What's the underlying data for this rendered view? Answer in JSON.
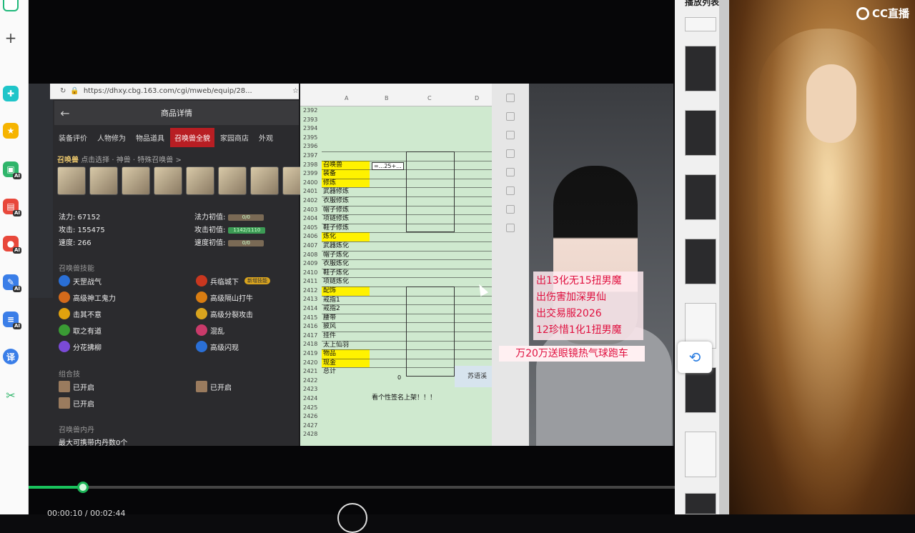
{
  "sidebar": {
    "icons": [
      "home-icon",
      "plus-icon",
      "clover-icon",
      "star-icon",
      "image-ai-icon",
      "pdf-ai-icon",
      "doc-ai-icon",
      "edit-ai-icon",
      "list-ai-icon",
      "translate-icon",
      "scissors-icon"
    ],
    "ai_badge": "AI",
    "translate_glyph": "译"
  },
  "browser": {
    "url": "https://dhxy.cbg.163.com/cgi/mweb/equip/28...",
    "page_title": "商品详情",
    "tabs": [
      "装备评价",
      "人物修为",
      "物品道具",
      "召唤兽全貌",
      "家园商店",
      "外观"
    ],
    "active_tab": "召唤兽全貌",
    "subhead_title": "召唤兽",
    "subhead_rest": "点击选择  ·  神兽  ·  特殊召唤兽 >",
    "stats": {
      "mana_label": "法力: 67152",
      "attack_label": "攻击: 155475",
      "speed_label": "速度: 266",
      "mana_init_label": "法力初值:",
      "mana_init_bar": "0/0",
      "attack_init_label": "攻击初值:",
      "attack_init_bar": "1142/1110",
      "speed_init_label": "速度初值:",
      "speed_init_bar": "0/0"
    },
    "skills_title": "召唤兽技能",
    "skills_left": [
      "天罡战气",
      "高级神工鬼力",
      "击其不意",
      "取之有道",
      "分花拂柳"
    ],
    "skills_right": [
      "兵临城下",
      "高级隔山打牛",
      "高级分裂攻击",
      "混乱",
      "高级闪现"
    ],
    "skill_tag": "新增技能",
    "combo_title": "组合技",
    "combo": [
      "已开启",
      "已开启",
      "已开启"
    ],
    "pill_title": "召唤兽内丹",
    "pill_text": "最大可携带内丹数0个"
  },
  "sheet": {
    "columns": [
      "A",
      "B",
      "C",
      "D"
    ],
    "first_row": 2392,
    "rows": [
      "2392",
      "2393",
      "2394",
      "2395",
      "2396",
      "2397",
      "2398",
      "2399",
      "2400",
      "2401",
      "2402",
      "2403",
      "2404",
      "2405",
      "2406",
      "2407",
      "2408",
      "2409",
      "2410",
      "2411",
      "2412",
      "2413",
      "2414",
      "2415",
      "2416",
      "2417",
      "2418",
      "2419",
      "2420",
      "2421",
      "2422",
      "2423",
      "2424",
      "2425",
      "2426",
      "2427",
      "2428"
    ],
    "labels": [
      {
        "row": 6,
        "text": "召唤兽",
        "yellow": true
      },
      {
        "row": 7,
        "text": "装备",
        "yellow": true
      },
      {
        "row": 8,
        "text": "修炼",
        "yellow": true
      },
      {
        "row": 9,
        "text": "武器修炼",
        "yellow": false
      },
      {
        "row": 10,
        "text": "衣服修炼",
        "yellow": false
      },
      {
        "row": 11,
        "text": "帽子修炼",
        "yellow": false
      },
      {
        "row": 12,
        "text": "项链修炼",
        "yellow": false
      },
      {
        "row": 13,
        "text": "鞋子修炼",
        "yellow": false
      },
      {
        "row": 14,
        "text": "炼化",
        "yellow": true
      },
      {
        "row": 15,
        "text": "武器炼化",
        "yellow": false
      },
      {
        "row": 16,
        "text": "帽子炼化",
        "yellow": false
      },
      {
        "row": 17,
        "text": "衣服炼化",
        "yellow": false
      },
      {
        "row": 18,
        "text": "鞋子炼化",
        "yellow": false
      },
      {
        "row": 19,
        "text": "项链炼化",
        "yellow": false
      },
      {
        "row": 20,
        "text": "配饰",
        "yellow": true
      },
      {
        "row": 21,
        "text": "戒指1",
        "yellow": false
      },
      {
        "row": 22,
        "text": "戒指2",
        "yellow": false
      },
      {
        "row": 23,
        "text": "腰带",
        "yellow": false
      },
      {
        "row": 24,
        "text": "披风",
        "yellow": false
      },
      {
        "row": 25,
        "text": "挂件",
        "yellow": false
      },
      {
        "row": 26,
        "text": "太上仙羽",
        "yellow": false
      },
      {
        "row": 27,
        "text": "物品",
        "yellow": true
      },
      {
        "row": 28,
        "text": "现金",
        "yellow": true
      },
      {
        "row": 29,
        "text": "总计",
        "yellow": false
      }
    ],
    "b_value": "0",
    "b_edit": "=...25+...",
    "note": "看个性签名上架！！！",
    "sidefield": "苏语溪"
  },
  "promo": {
    "lines": [
      "出13化无15扭男魔",
      "出伤害加深男仙",
      "出交易服2026",
      "12珍惜1化1扭男魔"
    ],
    "banner": "万20万送眼镜热气球跑车"
  },
  "player": {
    "time": "00:00:10 / 00:02:44",
    "progress": 0.0845
  },
  "playlist": {
    "title": "播放列表"
  },
  "poster": {
    "logo": "CC直播"
  }
}
